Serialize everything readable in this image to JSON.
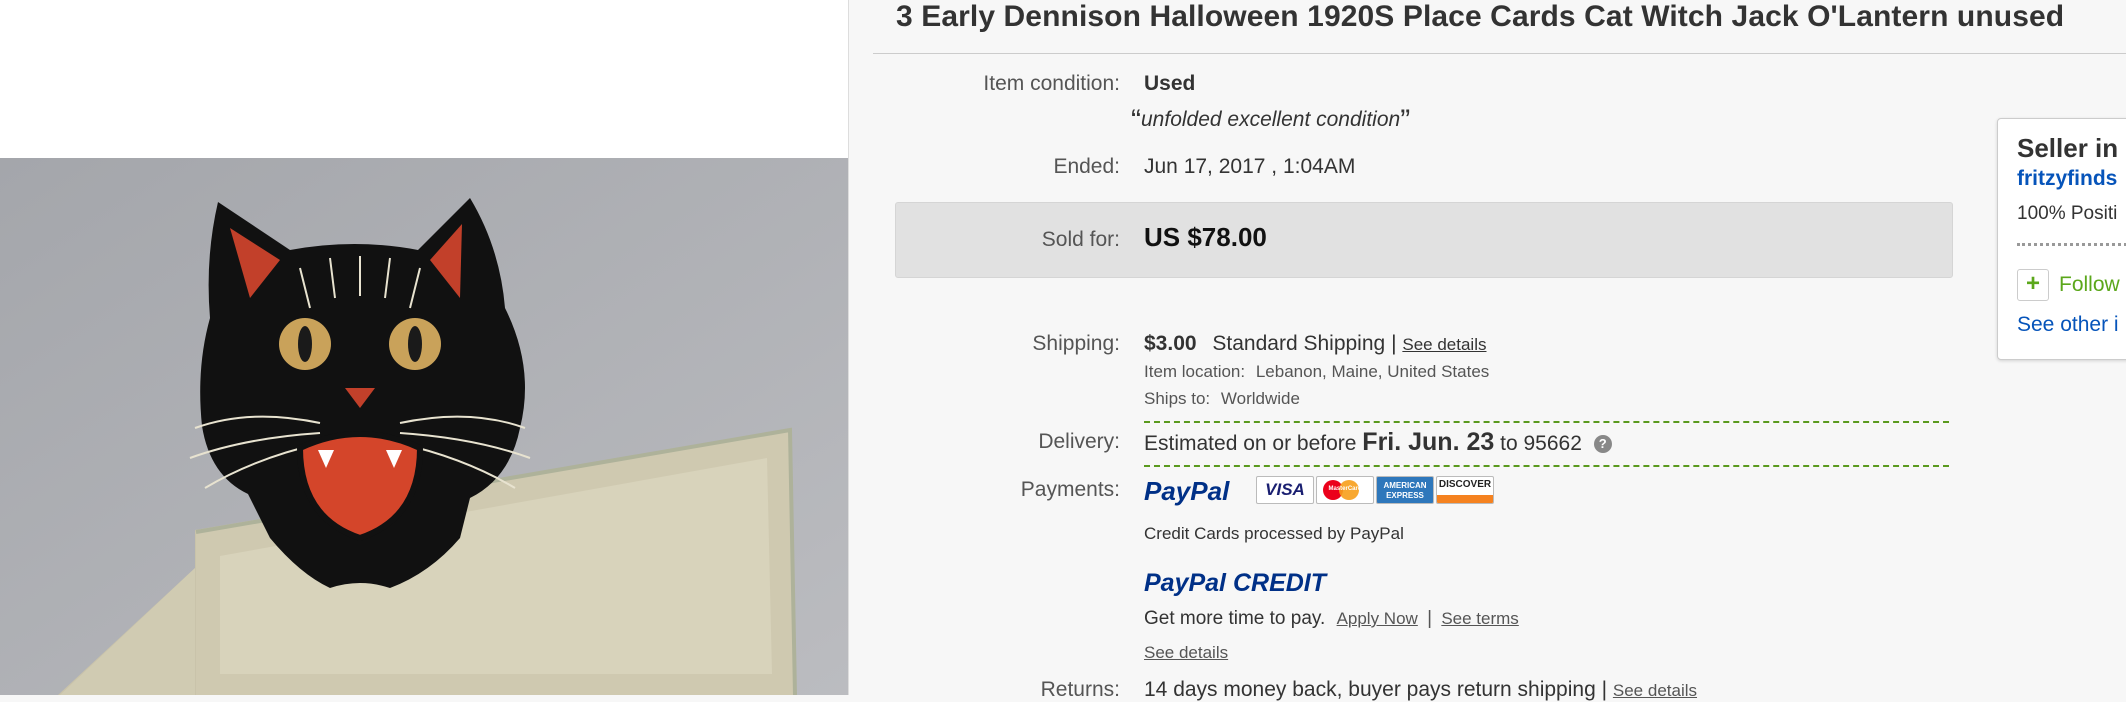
{
  "listing": {
    "title": "3 Early Dennison Halloween 1920S Place Cards Cat Witch Jack O'Lantern unused"
  },
  "condition": {
    "label": "Item condition:",
    "value": "Used",
    "note": "unfolded excellent condition"
  },
  "ended": {
    "label": "Ended:",
    "value": "Jun 17, 2017 , 1:04AM"
  },
  "sold": {
    "label": "Sold for:",
    "value": "US $78.00"
  },
  "shipping": {
    "label": "Shipping:",
    "price": "$3.00",
    "service": "Standard Shipping",
    "separator": "|",
    "details_link": "See details",
    "location_label": "Item location:",
    "location_value": "Lebanon, Maine, United States",
    "ships_to_label": "Ships to:",
    "ships_to_value": "Worldwide"
  },
  "delivery": {
    "label": "Delivery:",
    "prefix": "Estimated on or before",
    "date": "Fri. Jun. 23",
    "to_text": "to",
    "zip": "95662",
    "help_icon": "?"
  },
  "payments": {
    "label": "Payments:",
    "paypal_logo": "PayPal",
    "cards": [
      "VISA",
      "MasterCard",
      "AMERICAN EXPRESS",
      "DISCOVER"
    ],
    "processed_note": "Credit Cards processed by PayPal",
    "credit_logo_paypal": "PayPal",
    "credit_logo_credit": "CREDIT",
    "credit_tagline": "Get more time to pay.",
    "apply_now": "Apply Now",
    "separator": "|",
    "see_terms": "See terms",
    "see_details": "See details"
  },
  "returns": {
    "label": "Returns:",
    "value": "14 days money back, buyer pays return shipping |",
    "details_link": "See details"
  },
  "seller": {
    "heading": "Seller in",
    "name": "fritzyfinds",
    "positive": "100% Positi",
    "follow_plus": "+",
    "follow_label": "Follow",
    "see_other": "See other i"
  },
  "colors": {
    "link_blue": "#0654ba",
    "follow_green": "#5ba71b",
    "delivery_dash": "#5a9a1e",
    "sold_box": "#e1e1e1"
  }
}
